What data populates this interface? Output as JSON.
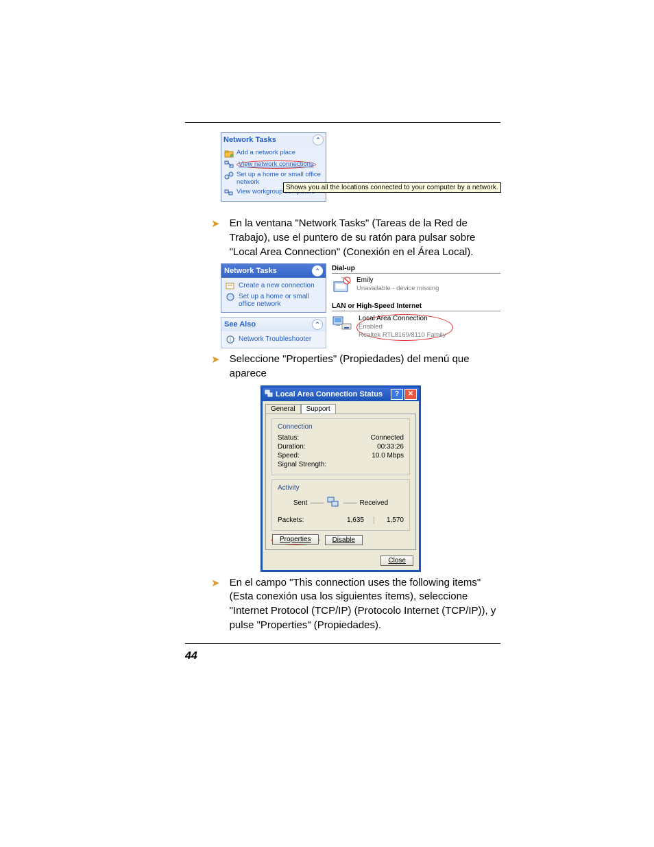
{
  "bullets": [
    "En la ventana \"Network Tasks\" (Tareas de la Red de Trabajo), use el puntero de su ratón para pulsar sobre \"Local Area Connection\" (Conexión en el Área Local).",
    "Seleccione \"Properties\" (Propiedades) del menú que aparece",
    "En el campo \"This connection uses the following items\" (Esta conexión usa los siguientes ítems), seleccione \"Internet Protocol (TCP/IP) (Protocolo Internet (TCP/IP)), y pulse \"Properties\" (Propiedades)."
  ],
  "page_number": "44",
  "fig1": {
    "header": "Network Tasks",
    "items": [
      "Add a network place",
      "View network connections",
      "Set up a home or small office network",
      "View workgroup computers"
    ],
    "tooltip": "Shows you all the locations connected to your computer by a network."
  },
  "fig2": {
    "nt_hdr": "Network Tasks",
    "nt_items": [
      "Create a new connection",
      "Set up a home or small office network"
    ],
    "sa_hdr": "See Also",
    "sa_items": [
      "Network Troubleshooter"
    ],
    "group1": "Dial-up",
    "dialup": {
      "name": "Emily",
      "status": "Unavailable - device missing"
    },
    "group2": "LAN or High-Speed Internet",
    "lan": {
      "name": "Local Area Connection",
      "status": "Enabled",
      "device": "Realtek RTL8169/8110 Family"
    }
  },
  "dlg": {
    "title": "Local Area Connection Status",
    "tab1": "General",
    "tab2": "Support",
    "legend1": "Connection",
    "status_l": "Status:",
    "status_v": "Connected",
    "dur_l": "Duration:",
    "dur_v": "00:33:26",
    "spd_l": "Speed:",
    "spd_v": "10.0 Mbps",
    "sig_l": "Signal Strength:",
    "legend2": "Activity",
    "sent": "Sent",
    "recv": "Received",
    "pkt_l": "Packets:",
    "pkt_s": "1,635",
    "pkt_r": "1,570",
    "btn_props": "Properties",
    "btn_dis": "Disable",
    "btn_close": "Close"
  }
}
